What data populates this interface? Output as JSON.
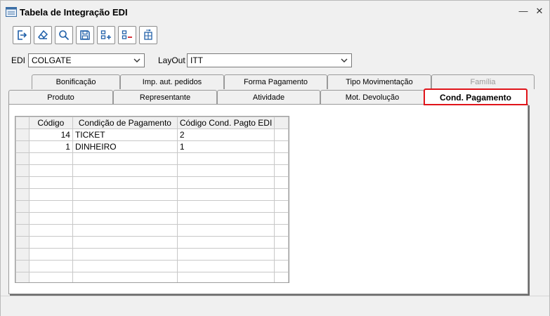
{
  "window": {
    "title": "Tabela de Integração EDI",
    "minimize": "—",
    "close": "✕"
  },
  "toolbar": {
    "buttons": [
      {
        "name": "exit-icon"
      },
      {
        "name": "eraser-icon"
      },
      {
        "name": "search-icon"
      },
      {
        "name": "save-icon"
      },
      {
        "name": "add-row-icon"
      },
      {
        "name": "remove-row-icon"
      },
      {
        "name": "move-rows-icon"
      }
    ]
  },
  "filters": {
    "edi_label": "EDI",
    "edi_value": "COLGATE",
    "layout_label": "LayOut",
    "layout_value": "ITT"
  },
  "tabs": {
    "row1": [
      "Bonificação",
      "Imp. aut. pedidos",
      "Forma Pagamento",
      "Tipo Movimentação",
      "Família"
    ],
    "row2": [
      "Produto",
      "Representante",
      "Atividade",
      "Mot. Devolução",
      "Cond. Pagamento"
    ],
    "active": "Cond. Pagamento"
  },
  "grid": {
    "columns": [
      "Código",
      "Condição de Pagamento",
      "Código Cond. Pagto EDI"
    ],
    "rows": [
      [
        "14",
        "TICKET",
        "2"
      ],
      [
        "1",
        "DINHEIRO",
        "1"
      ]
    ],
    "empty_rows": 11
  },
  "colors": {
    "accent": "#e0141a",
    "window_bg": "#f0f0f0"
  }
}
